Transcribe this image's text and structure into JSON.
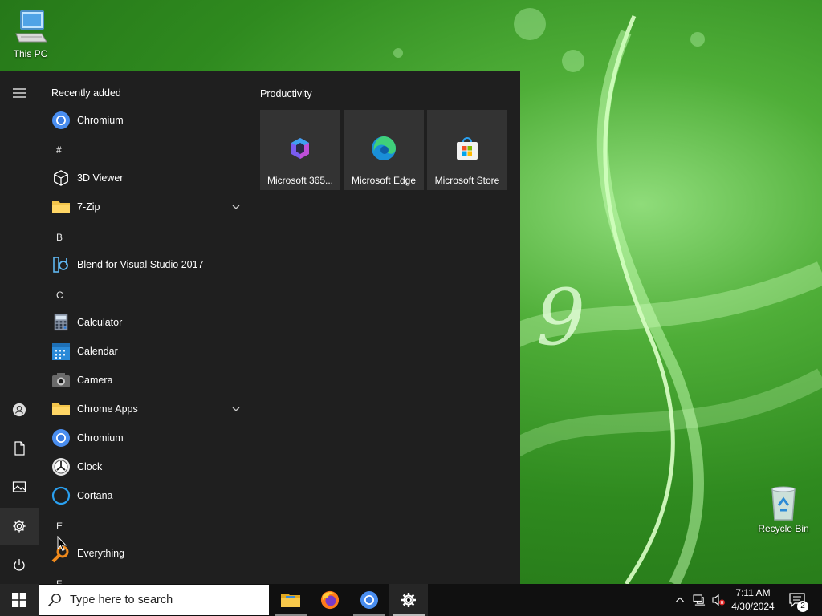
{
  "desktop": {
    "this_pc_label": "This PC",
    "recycle_bin_label": "Recycle Bin",
    "wallpaper_glyph": "9"
  },
  "start_menu": {
    "recently_added_title": "Recently added",
    "apps": {
      "chromium_recent": "Chromium",
      "hash_letter": "#",
      "three_d_viewer": "3D Viewer",
      "seven_zip": "7-Zip",
      "b_letter": "B",
      "blend": "Blend for Visual Studio 2017",
      "c_letter": "C",
      "calculator": "Calculator",
      "calendar": "Calendar",
      "camera": "Camera",
      "chrome_apps": "Chrome Apps",
      "chromium": "Chromium",
      "clock": "Clock",
      "cortana": "Cortana",
      "e_letter": "E",
      "everything": "Everything",
      "f_letter": "F"
    },
    "tiles_group": "Productivity",
    "tiles": {
      "m365": "Microsoft 365...",
      "edge": "Microsoft Edge",
      "store": "Microsoft Store"
    }
  },
  "taskbar": {
    "search_placeholder": "Type here to search",
    "clock_time": "7:11 AM",
    "clock_date": "4/30/2024",
    "notification_count": "2"
  },
  "colors": {
    "start_bg": "#1f1f1f",
    "taskbar_bg": "#101010",
    "accent_blue": "#0a6cd6"
  }
}
